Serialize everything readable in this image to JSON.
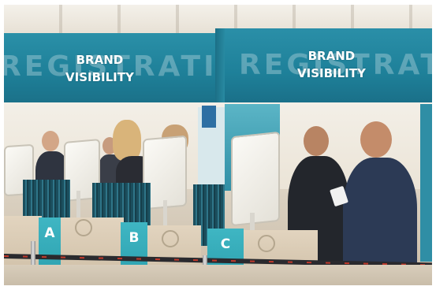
{
  "scene": {
    "description_role": "photo",
    "banner_left": {
      "background_word": "REGISTRATION",
      "overlay_line1": "BRAND",
      "overlay_line2": "VISIBILITY"
    },
    "banner_right": {
      "background_word": "REGISTRATION",
      "overlay_line1": "BRAND",
      "overlay_line2": "VISIBILITY"
    },
    "counters": [
      {
        "letter": "A"
      },
      {
        "letter": "B"
      },
      {
        "letter": "C"
      }
    ]
  },
  "colors": {
    "banner_teal": "#1e7f98",
    "counter_teal": "#2a9eac",
    "wood": "#cdbda4"
  }
}
